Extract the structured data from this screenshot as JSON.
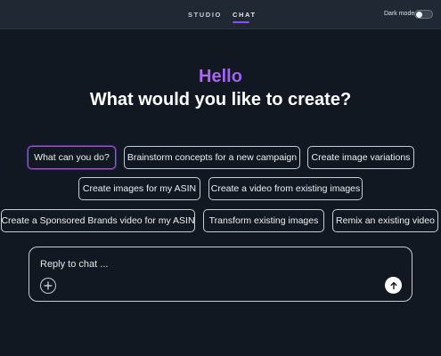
{
  "nav": {
    "tabs": [
      {
        "label": "STUDIO",
        "active": false
      },
      {
        "label": "CHAT",
        "active": true
      }
    ],
    "dark_mode_label": "Dark mode",
    "dark_mode_on": false,
    "accent_color": "#8e4ff6"
  },
  "hero": {
    "greeting": "Hello",
    "question": "What would you like to create?"
  },
  "suggestions": [
    {
      "label": "What can you do?",
      "selected": true
    },
    {
      "label": "Brainstorm concepts for a new campaign",
      "selected": false
    },
    {
      "label": "Create image variations",
      "selected": false
    },
    {
      "label": "Create images for my ASIN",
      "selected": false
    },
    {
      "label": "Create a video from existing images",
      "selected": false
    },
    {
      "label": "Create a Sponsored Brands video for my ASIN",
      "selected": false
    },
    {
      "label": "Transform existing images",
      "selected": false
    },
    {
      "label": "Remix an existing video",
      "selected": false
    }
  ],
  "composer": {
    "placeholder": "Reply to chat ...",
    "value": "",
    "add_icon": "plus-icon",
    "send_icon": "arrow-up-icon"
  }
}
